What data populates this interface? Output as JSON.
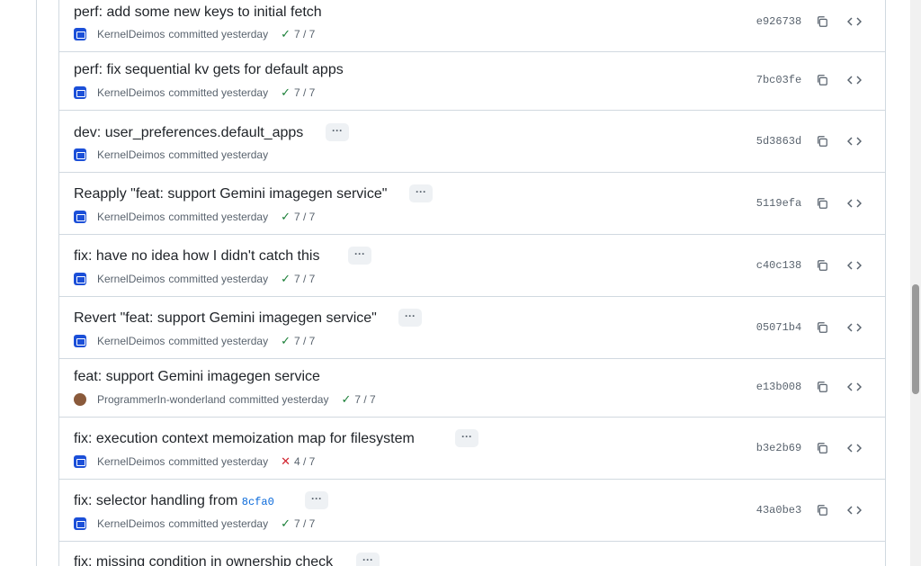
{
  "commits": [
    {
      "title": "perf: add some new keys to initial fetch",
      "author": "KernelDeimos",
      "time": "committed yesterday",
      "status": "7 / 7",
      "status_ok": true,
      "sha": "e926738",
      "has_more": false
    },
    {
      "title": "perf: fix sequential kv gets for default apps",
      "author": "KernelDeimos",
      "time": "committed yesterday",
      "status": "7 / 7",
      "status_ok": true,
      "sha": "7bc03fe",
      "has_more": false
    },
    {
      "title": "dev: user_preferences.default_apps",
      "author": "KernelDeimos",
      "time": "committed yesterday",
      "status": "",
      "status_ok": true,
      "sha": "5d3863d",
      "has_more": true
    },
    {
      "title": "Reapply \"feat: support Gemini imagegen service\"",
      "author": "KernelDeimos",
      "time": "committed yesterday",
      "status": "7 / 7",
      "status_ok": true,
      "sha": "5119efa",
      "has_more": true
    },
    {
      "title": "fix: have no idea how I didn't catch this",
      "author": "KernelDeimos",
      "time": "committed yesterday",
      "status": "7 / 7",
      "status_ok": true,
      "sha": "c40c138",
      "has_more": true
    },
    {
      "title": "Revert \"feat: support Gemini imagegen service\"",
      "author": "KernelDeimos",
      "time": "committed yesterday",
      "status": "7 / 7",
      "status_ok": true,
      "sha": "05071b4",
      "has_more": true
    },
    {
      "title": "feat: support Gemini imagegen service",
      "author": "ProgrammerIn-wonderland",
      "time": "committed yesterday",
      "status": "7 / 7",
      "status_ok": true,
      "sha": "e13b008",
      "has_more": false
    },
    {
      "title": "fix: execution context memoization map for filesystem",
      "author": "KernelDeimos",
      "time": "committed yesterday",
      "status": "4 / 7",
      "status_ok": false,
      "sha": "b3e2b69",
      "has_more": true
    },
    {
      "title": "fix: selector handling from",
      "title_ref": "8cfa0",
      "author": "KernelDeimos",
      "time": "committed yesterday",
      "status": "7 / 7",
      "status_ok": true,
      "sha": "43a0be3",
      "has_more": true
    },
    {
      "title": "fix: missing condition in ownership check",
      "author": "",
      "time": "",
      "status": "",
      "status_ok": true,
      "sha": "",
      "has_more": true
    }
  ],
  "icons": {
    "check": "check-icon",
    "cross": "x-icon",
    "copy": "copy-icon",
    "code": "code-icon",
    "more": "ellipsis-icon"
  },
  "colors": {
    "ok": "#1a7f37",
    "fail": "#d1242f",
    "link": "#0969da",
    "avatar": "#1b4fd8"
  }
}
